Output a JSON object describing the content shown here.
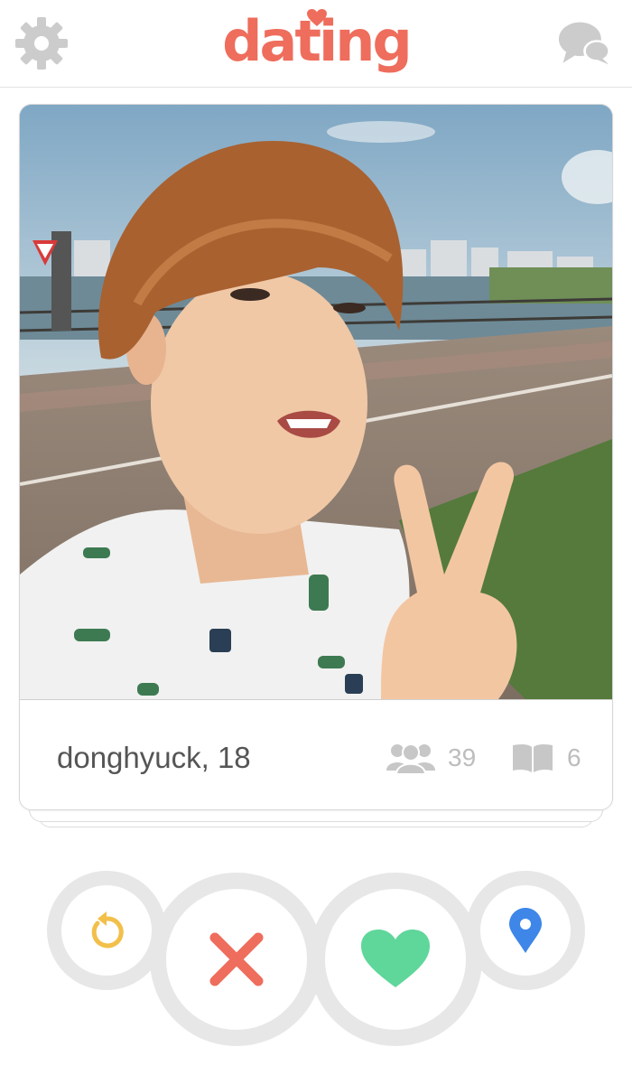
{
  "header": {
    "logo_text": "dating",
    "settings_icon": "gear-icon",
    "messages_icon": "chat-bubbles-icon"
  },
  "colors": {
    "brand": "#ee6d5c",
    "icon_gray": "#cccccc",
    "rewind": "#f2c04a",
    "nope": "#ee6d5c",
    "like": "#5fd69a",
    "location": "#3e86e8"
  },
  "profile": {
    "name_age": "donghyuck, 18",
    "friends_icon": "people-icon",
    "friends_count": "39",
    "pages_icon": "book-icon",
    "pages_count": "6",
    "photo": "profile-photo"
  },
  "actions": {
    "rewind_icon": "rewind-icon",
    "nope_icon": "x-icon",
    "like_icon": "heart-icon",
    "location_icon": "location-pin-icon"
  }
}
